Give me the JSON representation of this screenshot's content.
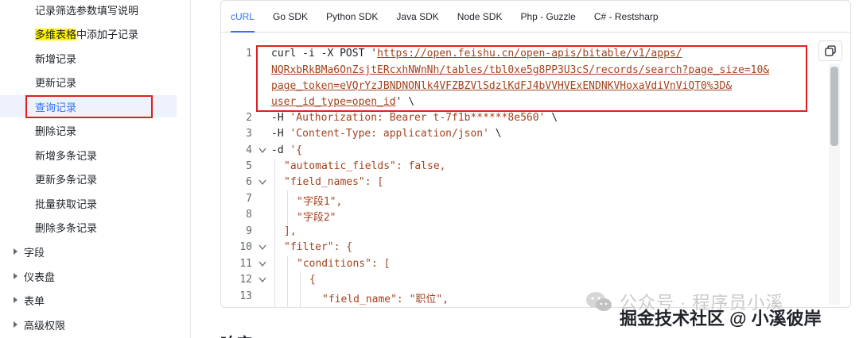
{
  "sidebar": {
    "items": [
      {
        "label": "记录筛选参数填写说明"
      },
      {
        "label_highlight": "多维表格",
        "label_rest": "中添加子记录"
      },
      {
        "label": "新增记录"
      },
      {
        "label": "更新记录"
      },
      {
        "label": "查询记录",
        "active": true
      },
      {
        "label": "删除记录"
      },
      {
        "label": "新增多条记录"
      },
      {
        "label": "更新多条记录"
      },
      {
        "label": "批量获取记录"
      },
      {
        "label": "删除多条记录"
      }
    ],
    "groups": [
      {
        "label": "字段"
      },
      {
        "label": "仪表盘"
      },
      {
        "label": "表单"
      },
      {
        "label": "高级权限"
      }
    ]
  },
  "code_tabs": [
    "cURL",
    "Go SDK",
    "Python SDK",
    "Java SDK",
    "Node SDK",
    "Php - Guzzle",
    "C# - Restsharp"
  ],
  "code": {
    "l1a": "curl -i -X POST '",
    "url1": "https://open.feishu.cn/open-apis/bitable/v1/apps/",
    "url2": "NQRxbRkBMa6OnZsjtERcxhNWnNh/tables/tbl0xe5g8PP3U3cS/records/search?page_size=10&",
    "url3": "page_token=eVQrYzJBNDNONlk4VFZBZVlSdzlKdFJ4bVVHVExENDNKVHoxaVdiVnViQT0%3D&",
    "url4": "user_id_type=open_id",
    "l1end": "' \\",
    "l2pre": "-H ",
    "l2str": "'Authorization: Bearer t-7f1b******8e560'",
    "l2end": " \\",
    "l3pre": "-H ",
    "l3str": "'Content-Type: application/json'",
    "l3end": " \\",
    "l4pre": "-d ",
    "l4str": "'{",
    "l5": "\"automatic_fields\": false,",
    "l6": "\"field_names\": [",
    "l7": "\"字段1\",",
    "l8": "\"字段2\"",
    "l9": "],",
    "l10": "\"filter\": {",
    "l11": "\"conditions\": [",
    "l12": "{",
    "l13": "\"field_name\": \"职位\","
  },
  "line_numbers": [
    "1",
    "2",
    "3",
    "4",
    "5",
    "6",
    "7",
    "8",
    "9",
    "10",
    "11",
    "12",
    "13"
  ],
  "heading_fragment": "响应",
  "watermark": {
    "line1": "公众号 · 程序员小溪",
    "line2": "掘金技术社区 @ 小溪彼岸"
  }
}
